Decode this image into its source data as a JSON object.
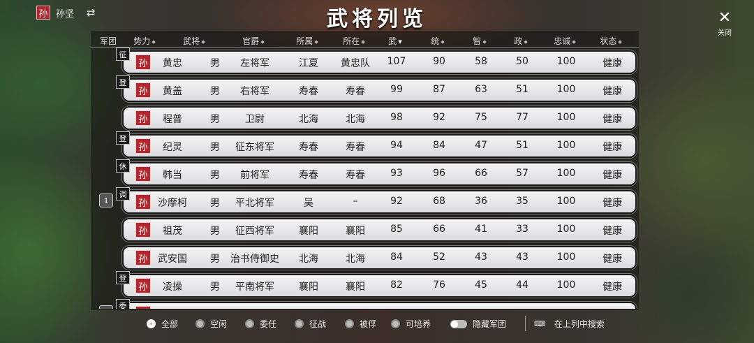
{
  "header": {
    "seal": "孙",
    "lord": "孙坚",
    "swap_icon": "⇄",
    "title": "武将列览",
    "close_icon": "✕",
    "close_label": "关闭"
  },
  "columns": [
    "军团",
    "势力",
    "武将",
    "官爵",
    "所属",
    "所在",
    "武",
    "统",
    "智",
    "政",
    "忠诚",
    "状态"
  ],
  "rows": [
    {
      "tag": "征",
      "corps": "",
      "faction": "孙",
      "name": "黄忠",
      "sex": "男",
      "rank": "左将军",
      "belong": "江夏",
      "loc": "黄忠队",
      "wu": "107",
      "tong": "90",
      "zhi": "58",
      "zheng": "50",
      "loyal": "100",
      "status": "健康"
    },
    {
      "tag": "登",
      "corps": "",
      "faction": "孙",
      "name": "黄盖",
      "sex": "男",
      "rank": "右将军",
      "belong": "寿春",
      "loc": "寿春",
      "wu": "99",
      "tong": "87",
      "zhi": "63",
      "zheng": "51",
      "loyal": "100",
      "status": "健康"
    },
    {
      "tag": "",
      "corps": "",
      "faction": "孙",
      "name": "程普",
      "sex": "男",
      "rank": "卫尉",
      "belong": "北海",
      "loc": "北海",
      "wu": "98",
      "tong": "92",
      "zhi": "75",
      "zheng": "77",
      "loyal": "100",
      "status": "健康"
    },
    {
      "tag": "登",
      "corps": "",
      "faction": "孙",
      "name": "纪灵",
      "sex": "男",
      "rank": "征东将军",
      "belong": "寿春",
      "loc": "寿春",
      "wu": "94",
      "tong": "84",
      "zhi": "47",
      "zheng": "51",
      "loyal": "100",
      "status": "健康"
    },
    {
      "tag": "休",
      "corps": "",
      "faction": "孙",
      "name": "韩当",
      "sex": "男",
      "rank": "前将军",
      "belong": "寿春",
      "loc": "寿春",
      "wu": "93",
      "tong": "96",
      "zhi": "66",
      "zheng": "57",
      "loyal": "100",
      "status": "健康"
    },
    {
      "tag": "调",
      "corps": "1",
      "faction": "孙",
      "name": "沙摩柯",
      "sex": "男",
      "rank": "平北将军",
      "belong": "吴",
      "loc": "–",
      "wu": "92",
      "tong": "68",
      "zhi": "36",
      "zheng": "35",
      "loyal": "100",
      "status": "健康"
    },
    {
      "tag": "",
      "corps": "",
      "faction": "孙",
      "name": "祖茂",
      "sex": "男",
      "rank": "征西将军",
      "belong": "襄阳",
      "loc": "襄阳",
      "wu": "85",
      "tong": "66",
      "zhi": "41",
      "zheng": "33",
      "loyal": "100",
      "status": "健康"
    },
    {
      "tag": "",
      "corps": "",
      "faction": "孙",
      "name": "武安国",
      "sex": "男",
      "rank": "治书侍御史",
      "belong": "北海",
      "loc": "北海",
      "wu": "84",
      "tong": "52",
      "zhi": "43",
      "zheng": "43",
      "loyal": "100",
      "status": "健康"
    },
    {
      "tag": "登",
      "corps": "",
      "faction": "孙",
      "name": "凌操",
      "sex": "男",
      "rank": "平南将军",
      "belong": "襄阳",
      "loc": "襄阳",
      "wu": "82",
      "tong": "76",
      "zhi": "45",
      "zheng": "44",
      "loyal": "100",
      "status": "健康"
    },
    {
      "tag": "委",
      "corps": "",
      "faction": "孙",
      "name": "",
      "sex": "",
      "rank": "",
      "belong": "",
      "loc": "",
      "wu": "",
      "tong": "",
      "zhi": "",
      "zheng": "",
      "loyal": "",
      "status": ""
    }
  ],
  "footer": {
    "filters": [
      "全部",
      "空闲",
      "委任",
      "征战",
      "被俘",
      "可培养"
    ],
    "selected": "全部",
    "hide_corps": "隐藏军团",
    "search_icon": "⌨",
    "search": "在上列中搜索"
  },
  "colors": {
    "seal": "#b3262d",
    "row_bg": "#e8e7ea",
    "radio_on": "#d2b36f"
  }
}
